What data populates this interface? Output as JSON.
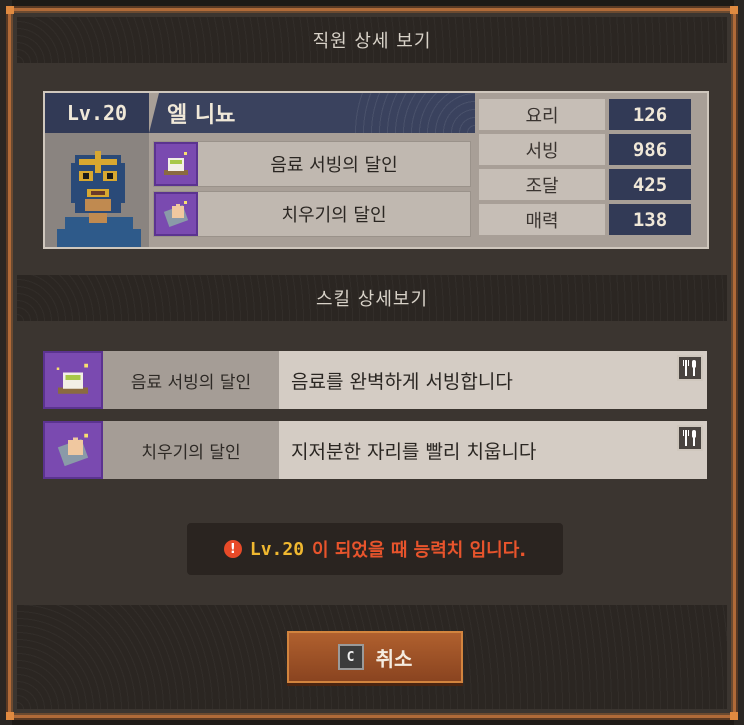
{
  "dialog": {
    "title": "직원 상세 보기",
    "skill_section_title": "스킬 상세보기"
  },
  "employee": {
    "level": "Lv.20",
    "name": "엘 니뇨",
    "badges": [
      {
        "label": "음료 서빙의 달인",
        "icon": "tea-cup-icon"
      },
      {
        "label": "치우기의 달인",
        "icon": "cleaning-hand-icon"
      }
    ],
    "stats": [
      {
        "name": "요리",
        "value": "126"
      },
      {
        "name": "서빙",
        "value": "986"
      },
      {
        "name": "조달",
        "value": "425"
      },
      {
        "name": "매력",
        "value": "138"
      }
    ]
  },
  "skills": [
    {
      "name": "음료 서빙의 달인",
      "description": "음료를 완벽하게 서빙합니다",
      "icon": "tea-cup-icon",
      "tag_icon": "cutlery-icon"
    },
    {
      "name": "치우기의 달인",
      "description": "지저분한 자리를 빨리 치웁니다",
      "icon": "cleaning-hand-icon",
      "tag_icon": "cutlery-icon"
    }
  ],
  "notice": {
    "icon": "!",
    "level": "Lv.20",
    "text": "이 되었을 때 능력치 입니다."
  },
  "footer": {
    "cancel_key": "C",
    "cancel_label": "취소"
  },
  "colors": {
    "accent_orange": "#b06a38",
    "level_navy": "#323a56",
    "skill_purple": "#7a4ab0",
    "notice_red": "#e8542c",
    "notice_gold": "#f0b830"
  }
}
